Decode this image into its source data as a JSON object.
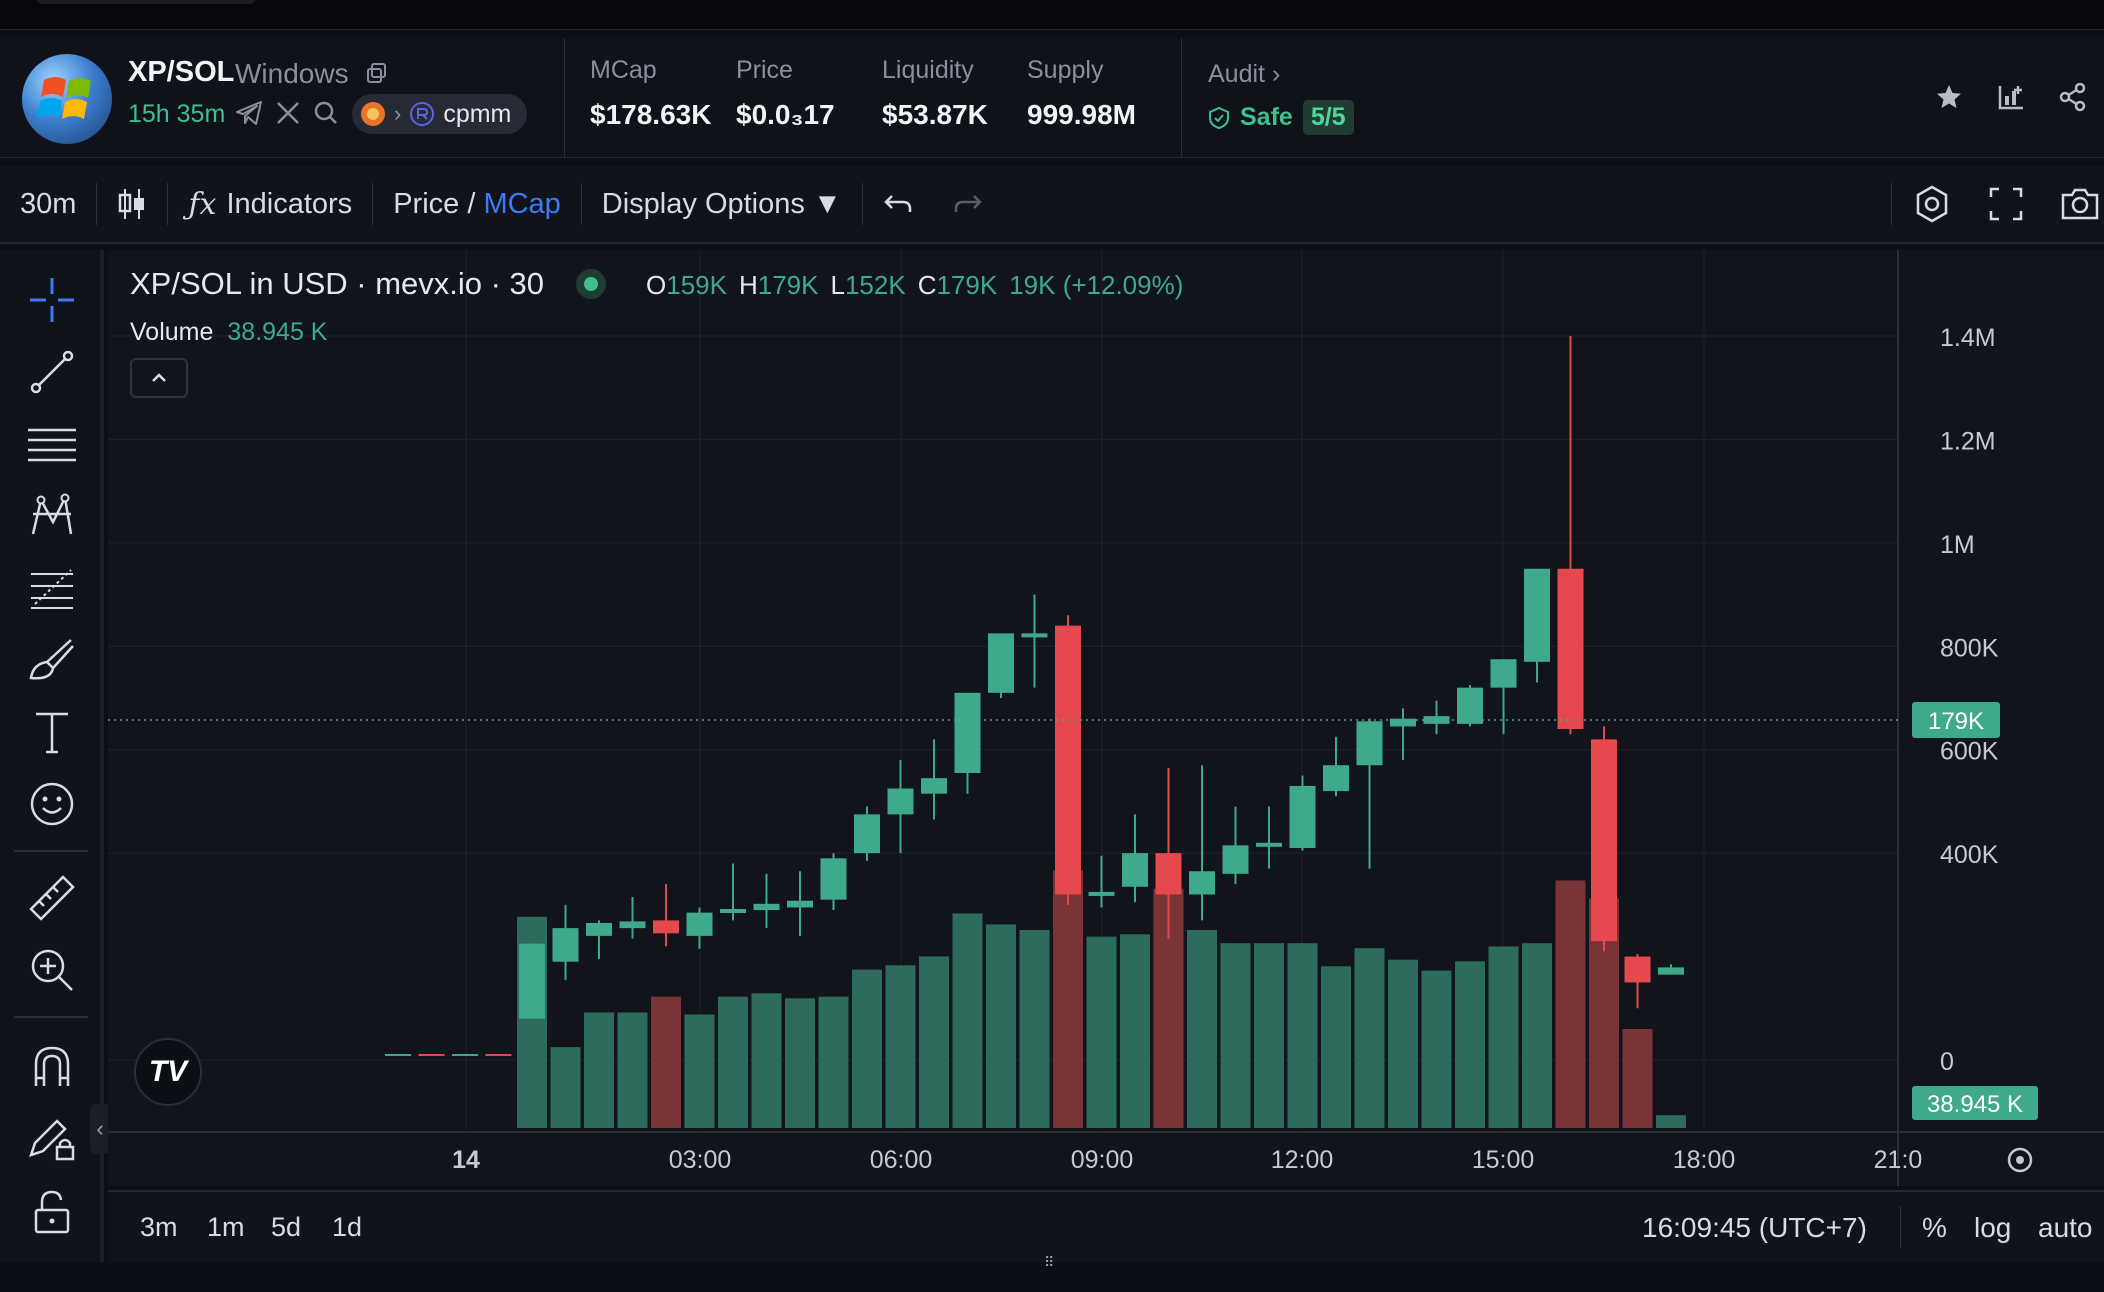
{
  "token": {
    "pair": "XP/SOL",
    "name": "Windows",
    "age": "15h 35m",
    "dex": "cpmm"
  },
  "stats": [
    {
      "label": "MCap",
      "value": "$178.63K"
    },
    {
      "label": "Price",
      "value": "$0.0₃17"
    },
    {
      "label": "Liquidity",
      "value": "$53.87K"
    },
    {
      "label": "Supply",
      "value": "999.98M"
    }
  ],
  "audit": {
    "label": "Audit",
    "status": "Safe",
    "score": "5/5"
  },
  "toolbar": {
    "interval": "30m",
    "indicators": "Indicators",
    "price_label": "Price",
    "slash": " / ",
    "mcap_label": "MCap",
    "display_options": "Display Options ▼"
  },
  "legend": {
    "title": "XP/SOL in USD · mevx.io · 30",
    "o_key": "O",
    "o": "159K",
    "h_key": "H",
    "h": "179K",
    "l_key": "L",
    "l": "152K",
    "c_key": "C",
    "c": "179K",
    "change": "19K (+12.09%)",
    "volume_label": "Volume",
    "volume_value": "38.945 K"
  },
  "axes": {
    "y_ticks": [
      "1.4M",
      "1.2M",
      "1M",
      "800K",
      "600K",
      "400K",
      "0"
    ],
    "x_ticks": [
      "14",
      "03:00",
      "06:00",
      "09:00",
      "12:00",
      "15:00",
      "18:00",
      "21:0"
    ],
    "price_tag": "179K",
    "volume_tag": "38.945 K"
  },
  "colors": {
    "up": "#3fa98b",
    "down": "#e5484d",
    "up_vol": "#2d6b5c",
    "down_vol": "#7a3438"
  },
  "chart_data": {
    "type": "candlestick",
    "ylim": [
      0,
      1400000
    ],
    "candles": [
      {
        "o": 0,
        "h": 0,
        "l": 0,
        "c": 0,
        "v": 0
      },
      {
        "o": 0,
        "h": 0,
        "l": 0,
        "c": 0,
        "v": 0
      },
      {
        "o": 0,
        "h": 0,
        "l": 0,
        "c": 0,
        "v": 0
      },
      {
        "o": 0,
        "h": 0,
        "l": 0,
        "c": 0,
        "v": 0
      },
      {
        "o": 80000,
        "h": 225000,
        "l": 80000,
        "c": 225000,
        "v": 640
      },
      {
        "o": 190000,
        "h": 300000,
        "l": 155000,
        "c": 255000,
        "v": 245
      },
      {
        "o": 240000,
        "h": 270000,
        "l": 195000,
        "c": 265000,
        "v": 350
      },
      {
        "o": 255000,
        "h": 315000,
        "l": 235000,
        "c": 268000,
        "v": 350
      },
      {
        "o": 270000,
        "h": 340000,
        "l": 220000,
        "c": 245000,
        "v": 398
      },
      {
        "o": 240000,
        "h": 295000,
        "l": 215000,
        "c": 285000,
        "v": 344
      },
      {
        "o": 290000,
        "h": 380000,
        "l": 270000,
        "c": 292000,
        "v": 398
      },
      {
        "o": 290000,
        "h": 360000,
        "l": 255000,
        "c": 302000,
        "v": 408
      },
      {
        "o": 295000,
        "h": 365000,
        "l": 240000,
        "c": 308000,
        "v": 393
      },
      {
        "o": 310000,
        "h": 400000,
        "l": 290000,
        "c": 390000,
        "v": 398
      },
      {
        "o": 400000,
        "h": 490000,
        "l": 385000,
        "c": 475000,
        "v": 480
      },
      {
        "o": 475000,
        "h": 580000,
        "l": 400000,
        "c": 525000,
        "v": 493
      },
      {
        "o": 515000,
        "h": 620000,
        "l": 465000,
        "c": 545000,
        "v": 520
      },
      {
        "o": 555000,
        "h": 685000,
        "l": 515000,
        "c": 710000,
        "v": 650
      },
      {
        "o": 710000,
        "h": 800000,
        "l": 700000,
        "c": 825000,
        "v": 617
      },
      {
        "o": 820000,
        "h": 900000,
        "l": 720000,
        "c": 825000,
        "v": 600
      },
      {
        "o": 840000,
        "h": 860000,
        "l": 300000,
        "c": 320000,
        "v": 780
      },
      {
        "o": 320000,
        "h": 395000,
        "l": 295000,
        "c": 325000,
        "v": 580
      },
      {
        "o": 335000,
        "h": 475000,
        "l": 305000,
        "c": 400000,
        "v": 587
      },
      {
        "o": 400000,
        "h": 565000,
        "l": 235000,
        "c": 320000,
        "v": 725
      },
      {
        "o": 320000,
        "h": 570000,
        "l": 270000,
        "c": 365000,
        "v": 600
      },
      {
        "o": 360000,
        "h": 490000,
        "l": 340000,
        "c": 415000,
        "v": 560
      },
      {
        "o": 420000,
        "h": 490000,
        "l": 370000,
        "c": 420000,
        "v": 560
      },
      {
        "o": 410000,
        "h": 550000,
        "l": 405000,
        "c": 530000,
        "v": 560
      },
      {
        "o": 520000,
        "h": 625000,
        "l": 510000,
        "c": 570000,
        "v": 490
      },
      {
        "o": 570000,
        "h": 660000,
        "l": 370000,
        "c": 655000,
        "v": 545
      },
      {
        "o": 645000,
        "h": 680000,
        "l": 580000,
        "c": 660000,
        "v": 510
      },
      {
        "o": 650000,
        "h": 695000,
        "l": 630000,
        "c": 665000,
        "v": 477
      },
      {
        "o": 650000,
        "h": 725000,
        "l": 645000,
        "c": 720000,
        "v": 505
      },
      {
        "o": 720000,
        "h": 760000,
        "l": 630000,
        "c": 775000,
        "v": 550
      },
      {
        "o": 770000,
        "h": 890000,
        "l": 730000,
        "c": 950000,
        "v": 560
      },
      {
        "o": 950000,
        "h": 1400000,
        "l": 630000,
        "c": 640000,
        "v": 750
      },
      {
        "o": 620000,
        "h": 645000,
        "l": 210000,
        "c": 230000,
        "v": 695
      },
      {
        "o": 200000,
        "h": 205000,
        "l": 100000,
        "c": 150000,
        "v": 300
      },
      {
        "o": 165000,
        "h": 185000,
        "l": 165000,
        "c": 179000,
        "v": 38.945
      }
    ]
  }
}
